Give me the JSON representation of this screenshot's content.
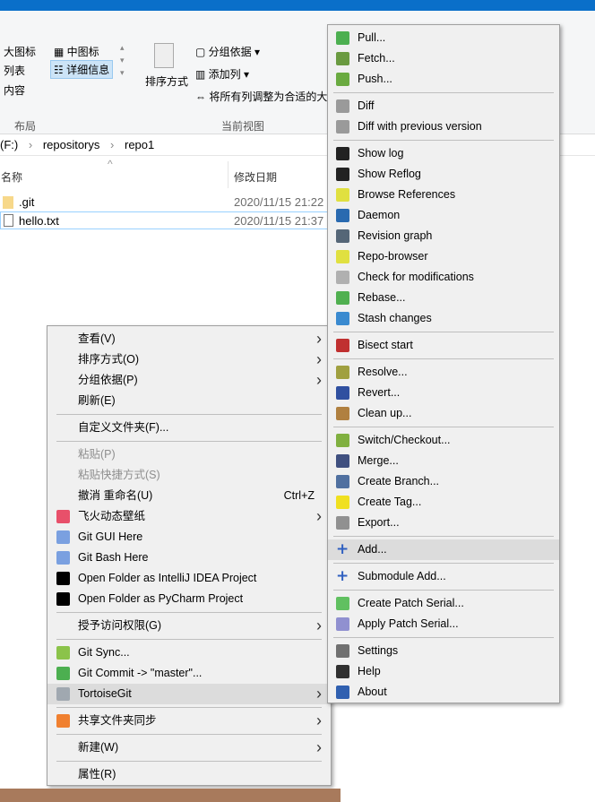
{
  "ribbon": {
    "layout": {
      "large_icons": "大图标",
      "medium_icons": "中图标",
      "list": "列表",
      "details": "详细信息",
      "content": "内容",
      "group": "布局"
    },
    "view": {
      "sort_by": "排序方式",
      "group_by": "分组依据",
      "add_column": "添加列",
      "fit_columns": "将所有列调整为合适的大",
      "group": "当前视图"
    }
  },
  "address": {
    "parts": [
      "(F:)",
      "repositorys",
      "repo1"
    ],
    "separator": "›"
  },
  "columns": {
    "name": "名称",
    "date": "修改日期"
  },
  "files": [
    {
      "name": ".git",
      "date": "2020/11/15 21:22",
      "icon": "folder-icon"
    },
    {
      "name": "hello.txt",
      "date": "2020/11/15 21:37",
      "icon": "text-file-icon"
    }
  ],
  "context_menu": [
    {
      "label": "查看(V)",
      "submenu": true
    },
    {
      "label": "排序方式(O)",
      "submenu": true
    },
    {
      "label": "分组依据(P)",
      "submenu": true
    },
    {
      "label": "刷新(E)"
    },
    {
      "sep": true
    },
    {
      "label": "自定义文件夹(F)..."
    },
    {
      "sep": true
    },
    {
      "label": "粘贴(P)",
      "disabled": true
    },
    {
      "label": "粘贴快捷方式(S)",
      "disabled": true
    },
    {
      "label": "撤消 重命名(U)",
      "shortcut": "Ctrl+Z"
    },
    {
      "label": "飞火动态壁纸",
      "submenu": true,
      "icon": "wallpaper-icon",
      "color": "#e8506a"
    },
    {
      "label": "Git GUI Here",
      "icon": "git-gui-icon",
      "color": "#7aa0e0"
    },
    {
      "label": "Git Bash Here",
      "icon": "git-bash-icon",
      "color": "#7aa0e0"
    },
    {
      "label": "Open Folder as IntelliJ IDEA Project",
      "icon": "intellij-icon",
      "color": "#000000"
    },
    {
      "label": "Open Folder as PyCharm Project",
      "icon": "pycharm-icon",
      "color": "#000000"
    },
    {
      "sep": true
    },
    {
      "label": "授予访问权限(G)",
      "submenu": true
    },
    {
      "sep": true
    },
    {
      "label": "Git Sync...",
      "icon": "git-sync-icon",
      "color": "#8bc34a"
    },
    {
      "label": "Git Commit -> \"master\"...",
      "icon": "git-commit-icon",
      "color": "#4caf50"
    },
    {
      "label": "TortoiseGit",
      "submenu": true,
      "highlight": true,
      "icon": "tortoisegit-icon",
      "color": "#a0a8b0"
    },
    {
      "sep": true
    },
    {
      "label": "共享文件夹同步",
      "submenu": true,
      "icon": "share-sync-icon",
      "color": "#f08030"
    },
    {
      "sep": true
    },
    {
      "label": "新建(W)",
      "submenu": true
    },
    {
      "sep": true
    },
    {
      "label": "属性(R)"
    }
  ],
  "tortoise_menu": [
    {
      "label": "Pull...",
      "icon": "pull-icon",
      "color": "#4caf50"
    },
    {
      "label": "Fetch...",
      "icon": "fetch-icon",
      "color": "#6a9a40"
    },
    {
      "label": "Push...",
      "icon": "push-icon",
      "color": "#6aaa40"
    },
    {
      "sep": true
    },
    {
      "label": "Diff",
      "icon": "diff-icon",
      "color": "#9a9a9a"
    },
    {
      "label": "Diff with previous version",
      "icon": "diff-previous-icon",
      "color": "#9a9a9a"
    },
    {
      "sep": true
    },
    {
      "label": "Show log",
      "icon": "log-icon",
      "color": "#222222"
    },
    {
      "label": "Show Reflog",
      "icon": "reflog-icon",
      "color": "#222222"
    },
    {
      "label": "Browse References",
      "icon": "references-icon",
      "color": "#e0e040"
    },
    {
      "label": "Daemon",
      "icon": "globe-icon",
      "color": "#2a6ab0"
    },
    {
      "label": "Revision graph",
      "icon": "revision-graph-icon",
      "color": "#556677"
    },
    {
      "label": "Repo-browser",
      "icon": "repo-browser-icon",
      "color": "#e0e040"
    },
    {
      "label": "Check for modifications",
      "icon": "check-modifications-icon",
      "color": "#b0b0b0"
    },
    {
      "label": "Rebase...",
      "icon": "rebase-icon",
      "color": "#50b050"
    },
    {
      "label": "Stash changes",
      "icon": "stash-icon",
      "color": "#3a8ad0"
    },
    {
      "sep": true
    },
    {
      "label": "Bisect start",
      "icon": "bisect-icon",
      "color": "#c03030"
    },
    {
      "sep": true
    },
    {
      "label": "Resolve...",
      "icon": "resolve-icon",
      "color": "#a0a040"
    },
    {
      "label": "Revert...",
      "icon": "revert-icon",
      "color": "#3050a0"
    },
    {
      "label": "Clean up...",
      "icon": "cleanup-icon",
      "color": "#b08040"
    },
    {
      "sep": true
    },
    {
      "label": "Switch/Checkout...",
      "icon": "switch-icon",
      "color": "#80b040"
    },
    {
      "label": "Merge...",
      "icon": "merge-icon",
      "color": "#405080"
    },
    {
      "label": "Create Branch...",
      "icon": "branch-icon",
      "color": "#5070a0"
    },
    {
      "label": "Create Tag...",
      "icon": "tag-icon",
      "color": "#f0e020"
    },
    {
      "label": "Export...",
      "icon": "export-icon",
      "color": "#909090"
    },
    {
      "sep": true
    },
    {
      "label": "Add...",
      "icon": "plus-icon",
      "color": "#3060c0",
      "highlight": true
    },
    {
      "sep": true
    },
    {
      "label": "Submodule Add...",
      "icon": "plus-icon",
      "color": "#3060c0"
    },
    {
      "sep": true
    },
    {
      "label": "Create Patch Serial...",
      "icon": "patch-icon",
      "color": "#60c060"
    },
    {
      "label": "Apply Patch Serial...",
      "icon": "apply-patch-icon",
      "color": "#9090d0"
    },
    {
      "sep": true
    },
    {
      "label": "Settings",
      "icon": "settings-icon",
      "color": "#707070"
    },
    {
      "label": "Help",
      "icon": "help-icon",
      "color": "#303030"
    },
    {
      "label": "About",
      "icon": "info-icon",
      "color": "#3060b0"
    }
  ]
}
